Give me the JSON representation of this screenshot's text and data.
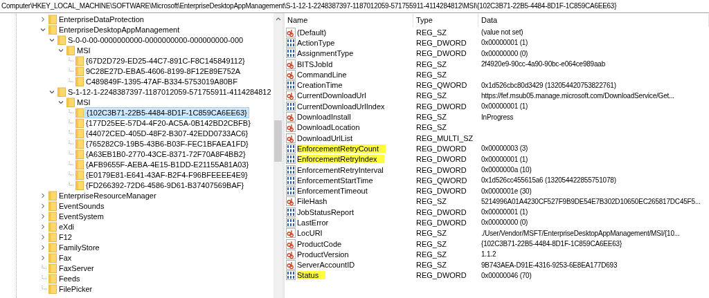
{
  "address_bar": {
    "path": "Computer\\HKEY_LOCAL_MACHINE\\SOFTWARE\\Microsoft\\EnterpriseDesktopAppManagement\\S-1-12-1-2248387397-1187012059-571755911-4114284812\\MSI\\{102C3B71-22B5-4484-8D1F-1C859CA6EE63}"
  },
  "tree": [
    {
      "label": "EnterpriseDataProtection",
      "kind": "branch",
      "expanded": false,
      "selected": false
    },
    {
      "label": "EnterpriseDesktopAppManagement",
      "kind": "branch",
      "expanded": true,
      "selected": false,
      "children": [
        {
          "label": "S-0-0-00-0000000000-0000000000-000000000-000",
          "kind": "branch",
          "expanded": true,
          "selected": false,
          "children": [
            {
              "label": "MSI",
              "kind": "branch",
              "expanded": true,
              "selected": false,
              "children": [
                {
                  "label": "{67D2D729-ED25-44C7-891C-F8C145849112}",
                  "kind": "leaf",
                  "selected": false
                },
                {
                  "label": "9C28E27D-EBA5-4606-8199-8F12E89E752A",
                  "kind": "leaf",
                  "selected": false
                },
                {
                  "label": "C489849F-1395-47AF-B334-5753019A80BF",
                  "kind": "leaf",
                  "selected": false
                }
              ]
            }
          ]
        },
        {
          "label": "S-1-12-1-2248387397-1187012059-571755911-4114284812",
          "kind": "branch",
          "expanded": true,
          "selected": false,
          "children": [
            {
              "label": "MSI",
              "kind": "branch",
              "expanded": true,
              "selected": false,
              "children": [
                {
                  "label": "{102C3B71-22B5-4484-8D1F-1C859CA6EE63}",
                  "kind": "leaf",
                  "selected": true
                },
                {
                  "label": "{177D25EE-57D4-4F20-AC5A-0B142BD2CBFB}",
                  "kind": "leaf",
                  "selected": false
                },
                {
                  "label": "{44072CED-405D-48F2-B307-42EDD0733AC6}",
                  "kind": "leaf",
                  "selected": false
                },
                {
                  "label": "{765282C9-19B5-43B6-B03F-FEC1BFAEA1FD}",
                  "kind": "leaf",
                  "selected": false
                },
                {
                  "label": "{A63EB1B0-2770-43CE-8371-72F70A8F4BB2}",
                  "kind": "leaf",
                  "selected": false
                },
                {
                  "label": "{AFB9655F-AEBA-4E15-B1DD-E21155A81A03}",
                  "kind": "leaf",
                  "selected": false
                },
                {
                  "label": "{E0179E81-E641-43AF-B2F4-F96BFEEEE4E9}",
                  "kind": "leaf",
                  "selected": false
                },
                {
                  "label": "{FD266392-72D6-4586-9D61-B37407569BAF}",
                  "kind": "leaf",
                  "selected": false
                }
              ]
            }
          ]
        }
      ]
    },
    {
      "label": "EnterpriseResourceManager",
      "kind": "branch",
      "expanded": false,
      "selected": false
    },
    {
      "label": "EventSounds",
      "kind": "branch",
      "expanded": false,
      "selected": false
    },
    {
      "label": "EventSystem",
      "kind": "branch",
      "expanded": false,
      "selected": false
    },
    {
      "label": "eXdi",
      "kind": "branch",
      "expanded": false,
      "selected": false
    },
    {
      "label": "F12",
      "kind": "branch",
      "expanded": false,
      "selected": false
    },
    {
      "label": "FamilyStore",
      "kind": "branch",
      "expanded": false,
      "selected": false
    },
    {
      "label": "Fax",
      "kind": "branch",
      "expanded": false,
      "selected": false
    },
    {
      "label": "FaxServer",
      "kind": "leaf",
      "selected": false
    },
    {
      "label": "Feeds",
      "kind": "leaf",
      "selected": false
    },
    {
      "label": "FilePicker",
      "kind": "leaf",
      "selected": false
    }
  ],
  "values": {
    "columns": [
      "Name",
      "Type",
      "Data"
    ],
    "rows": [
      {
        "name": "(Default)",
        "kind": "string",
        "type": "REG_SZ",
        "data": "(value not set)",
        "highlighted": false
      },
      {
        "name": "ActionType",
        "kind": "binary",
        "type": "REG_DWORD",
        "data": "0x00000001 (1)",
        "highlighted": false
      },
      {
        "name": "AssignmentType",
        "kind": "binary",
        "type": "REG_DWORD",
        "data": "0x00000000 (0)",
        "highlighted": false
      },
      {
        "name": "BITSJobId",
        "kind": "string",
        "type": "REG_SZ",
        "data": "2f4920e9-90cc-4a90-90bc-e064ce989aab",
        "highlighted": false
      },
      {
        "name": "CommandLine",
        "kind": "string",
        "type": "REG_SZ",
        "highlighted": false
      },
      {
        "name": "CreationTime",
        "kind": "binary",
        "type": "REG_QWORD",
        "data": "0x1d526cbc80d3429 (132054420753822761)",
        "highlighted": false
      },
      {
        "name": "CurrentDownloadUrl",
        "kind": "string",
        "type": "REG_SZ",
        "data": "https://fef.msub05.manage.microsoft.com/DownloadService/Get...",
        "highlighted": false
      },
      {
        "name": "CurrentDownloadUrlIndex",
        "kind": "binary",
        "type": "REG_DWORD",
        "data": "0x00000001 (1)",
        "highlighted": false
      },
      {
        "name": "DownloadInstall",
        "kind": "string",
        "type": "REG_SZ",
        "data": "InProgress",
        "highlighted": false
      },
      {
        "name": "DownloadLocation",
        "kind": "string",
        "type": "REG_SZ",
        "highlighted": false
      },
      {
        "name": "DownloadUrlList",
        "kind": "string",
        "type": "REG_MULTI_SZ",
        "highlighted": false
      },
      {
        "name": "EnforcementRetryCount",
        "kind": "binary",
        "type": "REG_DWORD",
        "data": "0x00000003 (3)",
        "highlighted": true
      },
      {
        "name": "EnforcementRetryIndex",
        "kind": "binary",
        "type": "REG_DWORD",
        "data": "0x00000001 (1)",
        "highlighted": true
      },
      {
        "name": "EnforcementRetryInterval",
        "kind": "binary",
        "type": "REG_DWORD",
        "data": "0x0000000a (10)",
        "highlighted": false
      },
      {
        "name": "EnforcementStartTime",
        "kind": "binary",
        "type": "REG_QWORD",
        "data": "0x1d526cc455615a6 (132054422855751078)",
        "highlighted": false
      },
      {
        "name": "EnforcementTimeout",
        "kind": "binary",
        "type": "REG_DWORD",
        "data": "0x0000001e (30)",
        "highlighted": false
      },
      {
        "name": "FileHash",
        "kind": "string",
        "type": "REG_SZ",
        "data": "5214996A01A4230CF527F9B9DE54E7B302D10650EC265817DC45F5...",
        "highlighted": false
      },
      {
        "name": "JobStatusReport",
        "kind": "binary",
        "type": "REG_DWORD",
        "data": "0x00000001 (1)",
        "highlighted": false
      },
      {
        "name": "LastError",
        "kind": "binary",
        "type": "REG_DWORD",
        "data": "0x00000000 (0)",
        "highlighted": false
      },
      {
        "name": "LocURI",
        "kind": "string",
        "type": "REG_SZ",
        "data": "./User/Vendor/MSFT/EnterpriseDesktopAppManagement/MSI/{10...",
        "highlighted": false
      },
      {
        "name": "ProductCode",
        "kind": "string",
        "type": "REG_SZ",
        "data": "{102C3B71-22B5-4484-8D1F-1C859CA6EE63}",
        "highlighted": false
      },
      {
        "name": "ProductVersion",
        "kind": "string",
        "type": "REG_SZ",
        "data": "1.1.2",
        "highlighted": false
      },
      {
        "name": "ServerAccountID",
        "kind": "string",
        "type": "REG_SZ",
        "data": "9B743AEA-D91E-4316-9253-6E8EA177D693",
        "highlighted": false
      },
      {
        "name": "Status",
        "kind": "binary",
        "type": "REG_DWORD",
        "data": "0x00000046 (70)",
        "highlighted": true
      }
    ]
  }
}
